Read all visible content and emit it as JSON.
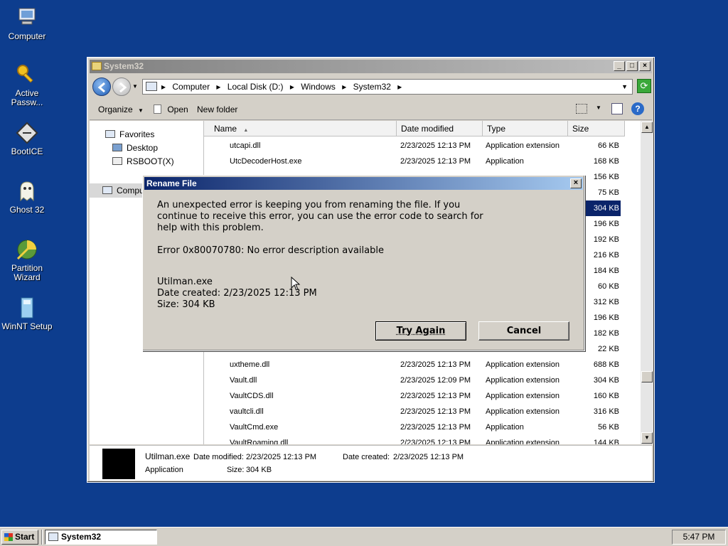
{
  "desktop": {
    "icons": [
      {
        "label": "Computer",
        "icon": "computer-icon"
      },
      {
        "label": "Active\nPassw...",
        "icon": "key-icon"
      },
      {
        "label": "BootICE",
        "icon": "bootice-icon"
      },
      {
        "label": "Ghost 32",
        "icon": "ghost-icon"
      },
      {
        "label": "Partition\nWizard",
        "icon": "partition-icon"
      },
      {
        "label": "WinNT Setup",
        "icon": "setup-icon"
      }
    ]
  },
  "explorer": {
    "title": "System32",
    "breadcrumb": [
      "Computer",
      "Local Disk (D:)",
      "Windows",
      "System32"
    ],
    "toolbar": {
      "organize": "Organize",
      "open": "Open",
      "new_folder": "New folder"
    },
    "nav": {
      "favorites": "Favorites",
      "desktop": "Desktop",
      "rsboot": "RSBOOT(X)",
      "computer": "Compu"
    },
    "columns": {
      "name": "Name",
      "date": "Date modified",
      "type": "Type",
      "size": "Size"
    },
    "rows_top": [
      {
        "name": "utcapi.dll",
        "date": "2/23/2025 12:13 PM",
        "type": "Application extension",
        "size": "66 KB"
      },
      {
        "name": "UtcDecoderHost.exe",
        "date": "2/23/2025 12:13 PM",
        "type": "Application",
        "size": "168 KB"
      }
    ],
    "hidden_sizes": [
      "156 KB",
      "75 KB",
      "304 KB",
      "196 KB",
      "192 KB",
      "216 KB",
      "184 KB",
      "60 KB",
      "312 KB",
      "196 KB",
      "182 KB",
      "22 KB"
    ],
    "rows_bottom": [
      {
        "name": "uxtheme.dll",
        "date": "2/23/2025 12:13 PM",
        "type": "Application extension",
        "size": "688 KB"
      },
      {
        "name": "Vault.dll",
        "date": "2/23/2025 12:09 PM",
        "type": "Application extension",
        "size": "304 KB"
      },
      {
        "name": "VaultCDS.dll",
        "date": "2/23/2025 12:13 PM",
        "type": "Application extension",
        "size": "160 KB"
      },
      {
        "name": "vaultcli.dll",
        "date": "2/23/2025 12:13 PM",
        "type": "Application extension",
        "size": "316 KB"
      },
      {
        "name": "VaultCmd.exe",
        "date": "2/23/2025 12:13 PM",
        "type": "Application",
        "size": "56 KB"
      },
      {
        "name": "VaultRoaming.dll",
        "date": "2/23/2025 12:13 PM",
        "type": "Application extension",
        "size": "144 KB"
      }
    ],
    "details": {
      "name": "Utilman.exe",
      "modified_label": "Date modified:",
      "modified": "2/23/2025 12:13 PM",
      "created_label": "Date created:",
      "created": "2/23/2025 12:13 PM",
      "type": "Application",
      "size_label": "Size:",
      "size": "304 KB"
    }
  },
  "dialog": {
    "title": "Rename File",
    "message": [
      "An unexpected error is keeping you from renaming the file. If you",
      "continue to receive this error, you can use the error code to search for",
      "help with this problem."
    ],
    "error": "Error 0x80070780: No error description available",
    "file_name": "Utilman.exe",
    "file_created": "Date created: 2/23/2025 12:13 PM",
    "file_size": "Size: 304 KB",
    "try_again": "Try Again",
    "cancel": "Cancel"
  },
  "taskbar": {
    "start": "Start",
    "task": "System32",
    "clock": "5:47 PM"
  }
}
